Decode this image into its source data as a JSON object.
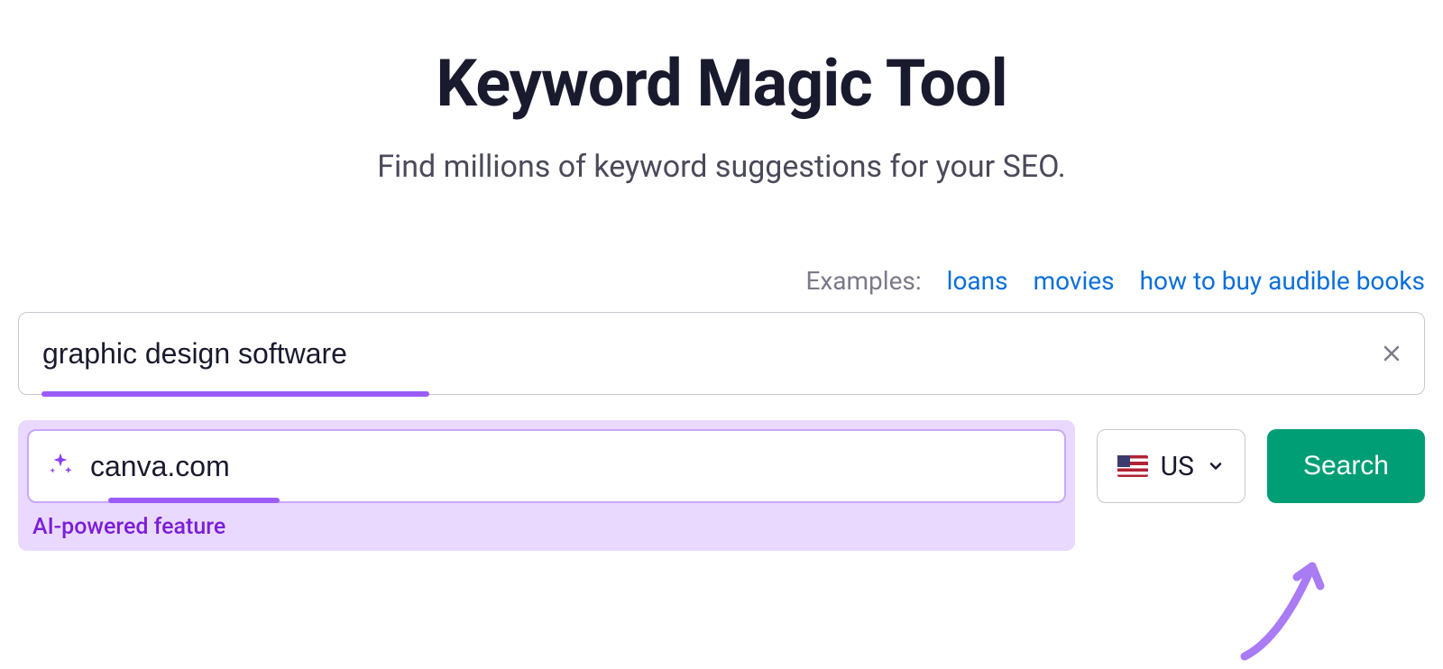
{
  "header": {
    "title": "Keyword Magic Tool",
    "subtitle": "Find millions of keyword suggestions for your SEO."
  },
  "examples": {
    "label": "Examples:",
    "items": [
      "loans",
      "movies",
      "how to buy audible books"
    ]
  },
  "keyword_input": {
    "value": "graphic design software"
  },
  "ai_box": {
    "domain_value": "canva.com",
    "label": "AI-powered feature"
  },
  "country": {
    "code": "US"
  },
  "search_button": {
    "label": "Search"
  }
}
